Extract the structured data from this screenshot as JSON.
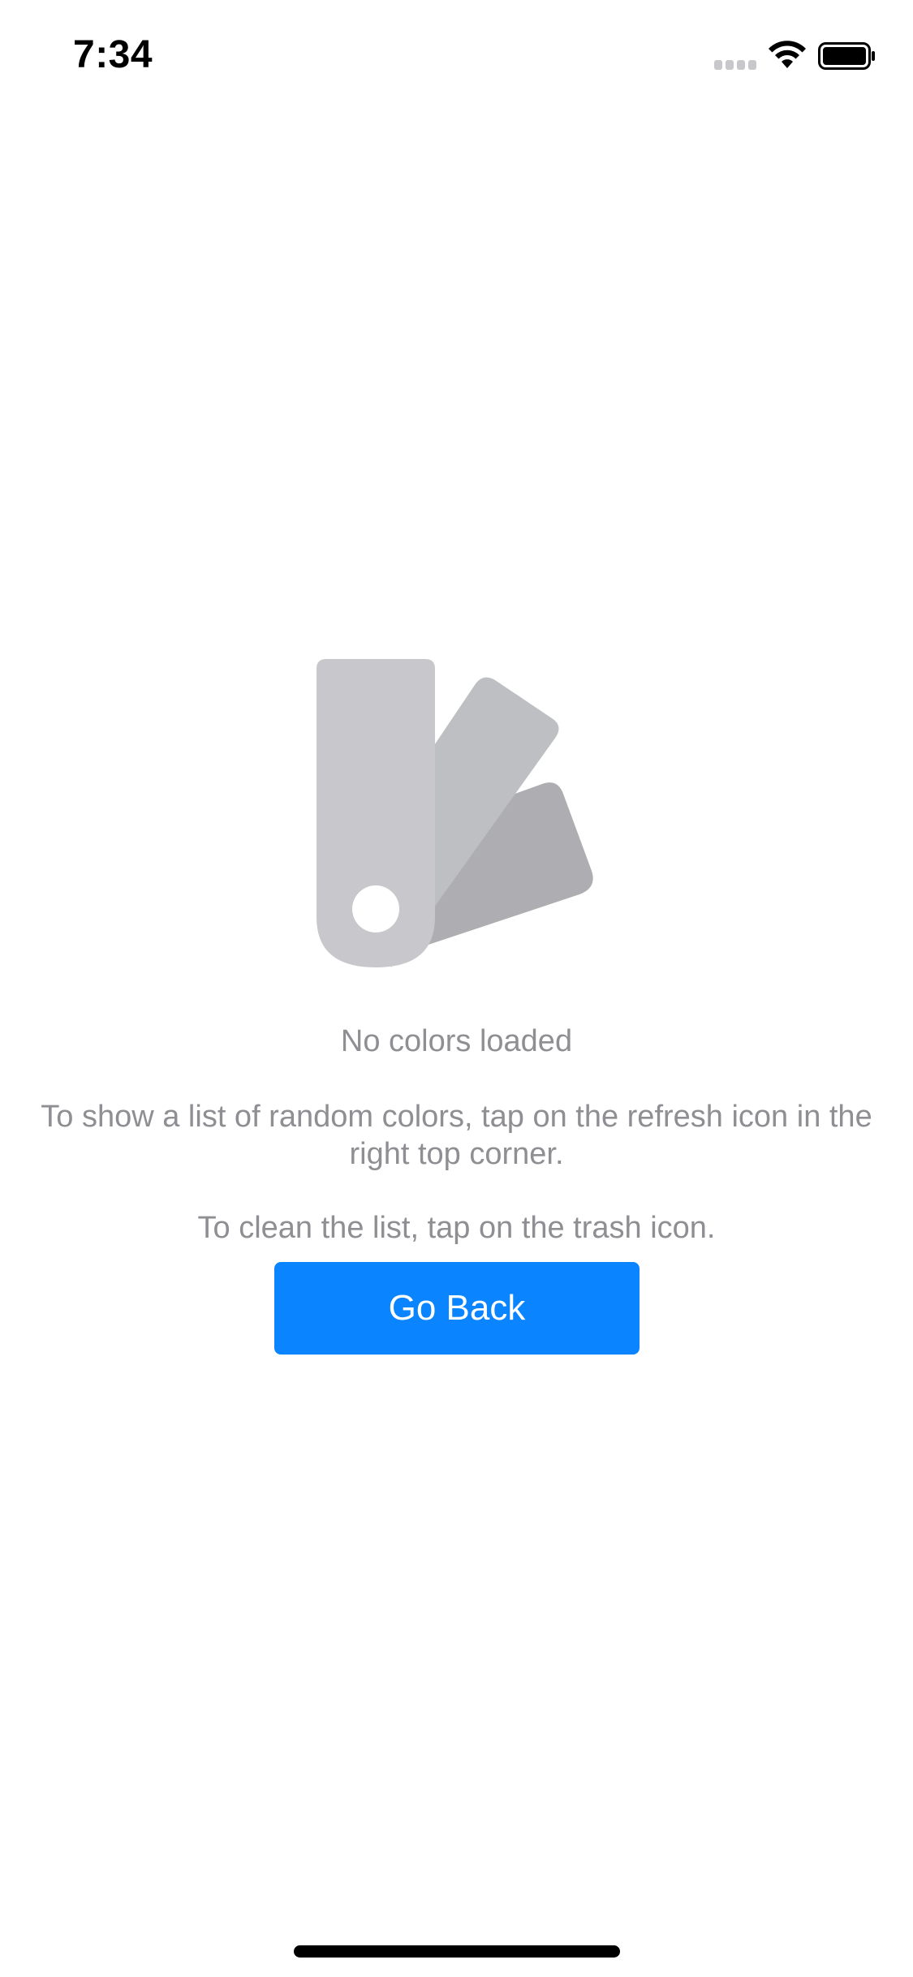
{
  "status_bar": {
    "time": "7:34",
    "icons": [
      "cellular-signal-icon",
      "wifi-icon",
      "battery-icon"
    ]
  },
  "empty_state": {
    "icon": "color-swatch-icon",
    "title": "No colors loaded",
    "description": "To show a list of random colors, tap on the refresh icon in the right top corner.",
    "hint": "To clean the list, tap on the trash icon."
  },
  "actions": {
    "go_back_label": "Go Back"
  },
  "colors": {
    "accent": "#0a84ff",
    "secondary_text": "#8e8e93",
    "swatch_light": "#c7c7cc",
    "swatch_mid": "#bebfc3",
    "swatch_dark": "#aeaeb2"
  }
}
